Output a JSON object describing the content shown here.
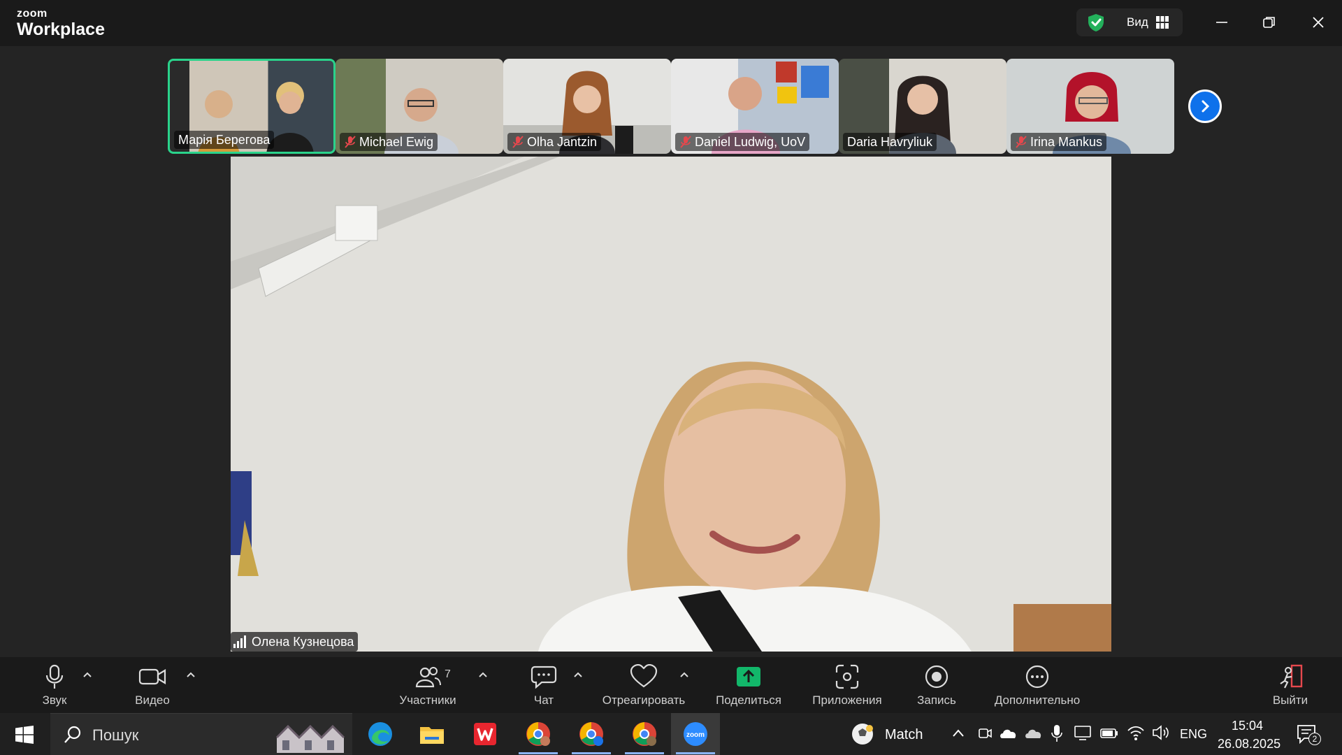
{
  "app": {
    "logo_small": "zoom",
    "logo_big": "Workplace"
  },
  "header": {
    "view_label": "Вид"
  },
  "participants_strip": [
    {
      "name": "Марія Берегова",
      "muted": false,
      "active": true
    },
    {
      "name": "Michael Ewig",
      "muted": true,
      "active": false
    },
    {
      "name": "Olha Jantzin",
      "muted": true,
      "active": false
    },
    {
      "name": "Daniel Ludwig, UoV",
      "muted": true,
      "active": false
    },
    {
      "name": "Daria Havryliuk",
      "muted": false,
      "active": false
    },
    {
      "name": "Irina Mankus",
      "muted": true,
      "active": false
    }
  ],
  "main_speaker": {
    "name": "Олена Кузнецова"
  },
  "toolbar": {
    "audio": "Звук",
    "video": "Видео",
    "participants": "Участники",
    "participants_count": "7",
    "chat": "Чат",
    "react": "Отреагировать",
    "share": "Поделиться",
    "apps": "Приложения",
    "record": "Запись",
    "more": "Дополнительно",
    "leave": "Выйти"
  },
  "taskbar": {
    "search_placeholder": "Пошук",
    "weather_label": "Match",
    "language": "ENG",
    "time": "15:04",
    "date": "26.08.2025",
    "notifications": "2"
  },
  "colors": {
    "active_border": "#2ad38b",
    "accent_blue": "#0e71eb",
    "share_green": "#12b76a",
    "muted_red": "#e5484d"
  }
}
